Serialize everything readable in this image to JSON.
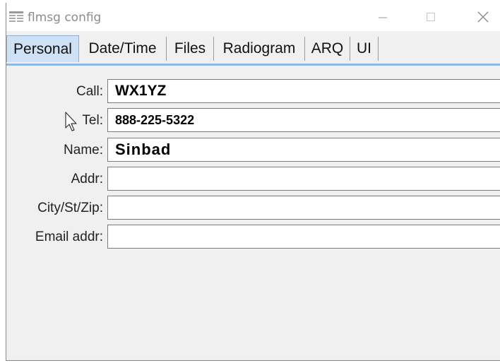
{
  "window": {
    "title": "flmsg config",
    "icon": "flmsg-app-icon",
    "controls": {
      "minimize": "minimize-icon",
      "maximize": "maximize-icon",
      "close": "close-icon"
    }
  },
  "tabs": [
    {
      "label": "Personal",
      "active": true
    },
    {
      "label": "Date/Time",
      "active": false
    },
    {
      "label": "Files",
      "active": false
    },
    {
      "label": "Radiogram",
      "active": false
    },
    {
      "label": "ARQ",
      "active": false
    },
    {
      "label": "UI",
      "active": false
    }
  ],
  "form": {
    "fields": [
      {
        "label": "Call:",
        "value": "WX1YZ"
      },
      {
        "label": "Tel:",
        "value": "888-225-5322"
      },
      {
        "label": "Name:",
        "value": "Sinbad"
      },
      {
        "label": "Addr:",
        "value": ""
      },
      {
        "label": "City/St/Zip:",
        "value": ""
      },
      {
        "label": "Email addr:",
        "value": ""
      }
    ]
  },
  "colors": {
    "active_tab": "#cfe1f5",
    "tab_underline": "#8db8e8",
    "window_bg": "#f0f0f0"
  }
}
